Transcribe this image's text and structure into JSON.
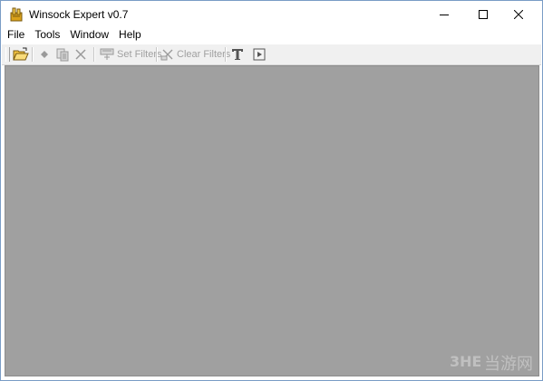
{
  "window": {
    "title": "Winsock Expert v0.7",
    "icon": "winsock-app-icon",
    "controls": [
      "minimize-icon",
      "maximize-icon",
      "close-icon"
    ]
  },
  "menu": {
    "items": [
      {
        "label": "File"
      },
      {
        "label": "Tools"
      },
      {
        "label": "Window"
      },
      {
        "label": "Help"
      }
    ]
  },
  "toolbar": {
    "open_icon": "open-folder-icon",
    "add_icon": "diamond-icon",
    "copy_icon": "copy-icon",
    "delete_icon": "delete-x-icon",
    "set_filters_label": "Set Filters",
    "clear_filters_label": "Clear Filters",
    "text_icon": "text-t-icon",
    "play_icon": "play-icon"
  },
  "watermark": {
    "text": "当游网"
  },
  "colors": {
    "client_background": "#a0a0a0",
    "toolbar_background": "#f0f0f0",
    "disabled_text": "#a0a0a0"
  }
}
